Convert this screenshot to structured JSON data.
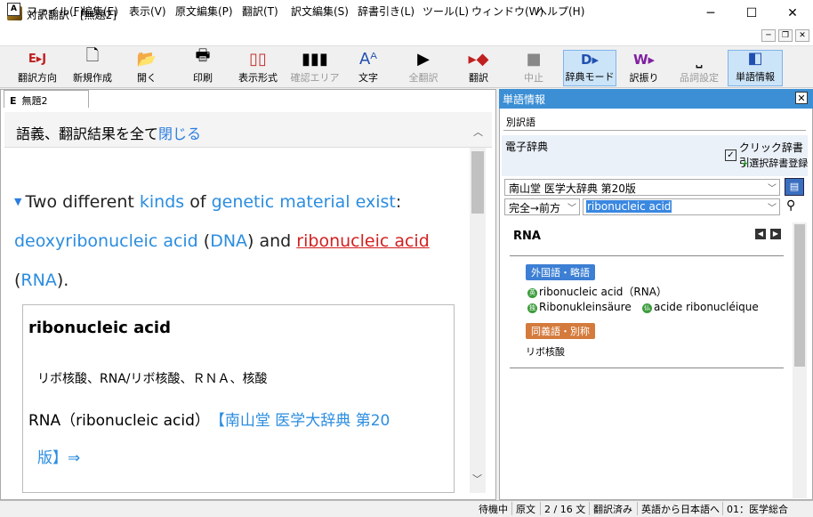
{
  "window": {
    "title": "対訳翻訳 - [無題2]",
    "min": "─",
    "max": "☐",
    "close": "✕"
  },
  "menu": [
    "ファイル(F)",
    "編集(E)",
    "表示(V)",
    "原文編集(P)",
    "翻訳(T)",
    "訳文編集(S)",
    "辞書引き(L)",
    "ツール(L)",
    "ウィンドウ(W)",
    "ヘルプ(H)"
  ],
  "mdi": {
    "min": "─",
    "restore": "❐",
    "close": "✕"
  },
  "toolbar": [
    {
      "label": "翻訳方向",
      "icon": "E▸J"
    },
    {
      "label": "新規作成",
      "icon": "🗋"
    },
    {
      "label": "開く",
      "icon": "📂"
    },
    {
      "label": "印刷",
      "icon": "🖶"
    },
    {
      "label": "表示形式",
      "icon": "▯▯"
    },
    {
      "label": "確認エリア",
      "icon": "▮▮▮"
    },
    {
      "label": "文字",
      "icon": "Aᴬ"
    },
    {
      "label": "全翻訳",
      "icon": "▶"
    },
    {
      "label": "翻訳",
      "icon": "▸◆"
    },
    {
      "label": "中止",
      "icon": "■"
    },
    {
      "label": "辞典モード",
      "icon": "D▸"
    },
    {
      "label": "訳振り",
      "icon": "W▸"
    },
    {
      "label": "品詞設定",
      "icon": "⎵"
    },
    {
      "label": "単語情報",
      "icon": "◧"
    }
  ],
  "doc": {
    "tab_prefix": "E",
    "tab_title": "無題2",
    "close_text": "語義、翻訳結果を全て",
    "close_link": "閉じる",
    "para": {
      "t1": "Two different ",
      "t2": "kinds",
      "t3": " of ",
      "t4": "genetic material exist",
      "t5": ":",
      "t6": "deoxyribonucleic acid",
      "t7": " (",
      "t8": "DNA",
      "t9": ") and ",
      "t10": "ribonucleic acid",
      "t11": "(",
      "t12": "RNA",
      "t13": ")."
    },
    "def": {
      "head": "ribonucleic acid",
      "ja": "リボ核酸、RNA/リボ核酸、ＲＮＡ、核酸",
      "term": "RNA（ribonucleic acid）",
      "src1": "【南山堂 医学大辞典 第20",
      "src2": "版】⇒"
    }
  },
  "word_info": {
    "header": "単語情報",
    "tab": "別訳語",
    "dict_label": "電子辞典",
    "click_dict": "クリック辞書引",
    "select_dict": "選択辞書登録",
    "dict_name": "南山堂 医学大辞典 第20版",
    "match": "完全→前方",
    "search": "ribonucleic acid",
    "term": "RNA",
    "badge1": "外国語・略語",
    "abbr1": "ribonucleic acid（RNA）",
    "abbr2": "Ribonukleinsäure",
    "abbr3": "acide ribonucléique",
    "badge2": "同義語・別称",
    "syn1": "リボ核酸",
    "g1": "英",
    "g2": "独",
    "g3": "仏"
  },
  "status": [
    "待機中",
    "原文",
    "2 / 16 文",
    "翻訳済み",
    "英語から日本語へ",
    "01：医学総合"
  ]
}
